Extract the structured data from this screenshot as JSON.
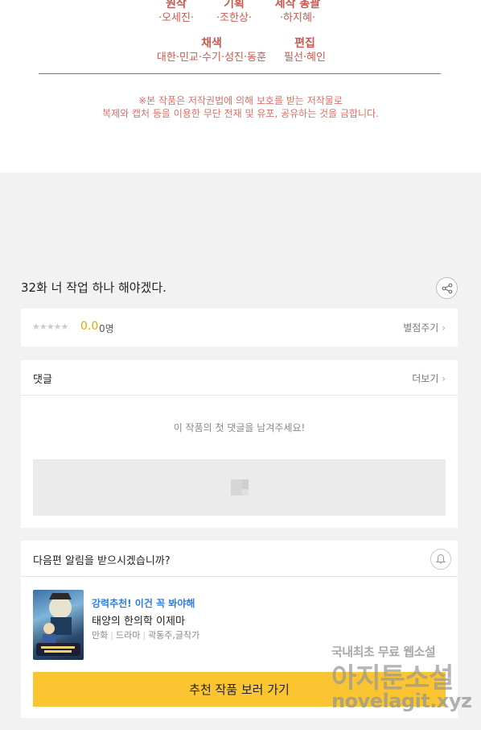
{
  "credits": [
    {
      "role": "원작",
      "names": "·오세진·"
    },
    {
      "role": "기획",
      "names": "·조한상·"
    },
    {
      "role": "제작 총괄",
      "names": "·하지혜·"
    },
    {
      "role": "채색",
      "names": "대한·민교·수기·성진·동훈"
    },
    {
      "role": "편집",
      "names": "필선·혜인"
    }
  ],
  "notice": {
    "line1": "※본 작품은 저작권법에 의해 보호를 받는 저작물로",
    "line2": "복제와 캡처 등을 이용한 무단 전재 및 유포, 공유하는 것을 금합니다."
  },
  "episode": {
    "title": "32화 너 작업 하나 해야겠다.",
    "share_icon": "share-icon"
  },
  "rating": {
    "stars": "★★★★★",
    "score": "0.0",
    "count": "0명",
    "rate_label": "별점주기"
  },
  "comments": {
    "title": "댓글",
    "more_label": "더보기",
    "empty_message": "이 작품의 첫 댓글을 남겨주세요!"
  },
  "notify": {
    "question": "다음편 알림을 받으시겠습니까?",
    "bell_icon": "bell-icon",
    "recommendation": {
      "tag": "강력추천! 이건 꼭 봐야해",
      "title": "태양의 한의학 이제마",
      "meta": [
        "만화",
        "드라마",
        "곽동주,글작가"
      ]
    },
    "cta_label": "추천 작품 보러 가기"
  },
  "watermark": {
    "line1": "국내최초 무료 웹소설",
    "line2": "아지툰소설",
    "line3": "novelagit.xyz"
  },
  "colors": {
    "credit": "#c9574f",
    "accent_yellow": "#fbc532",
    "tag_blue": "#2f7ce0",
    "score": "#e6a800"
  }
}
